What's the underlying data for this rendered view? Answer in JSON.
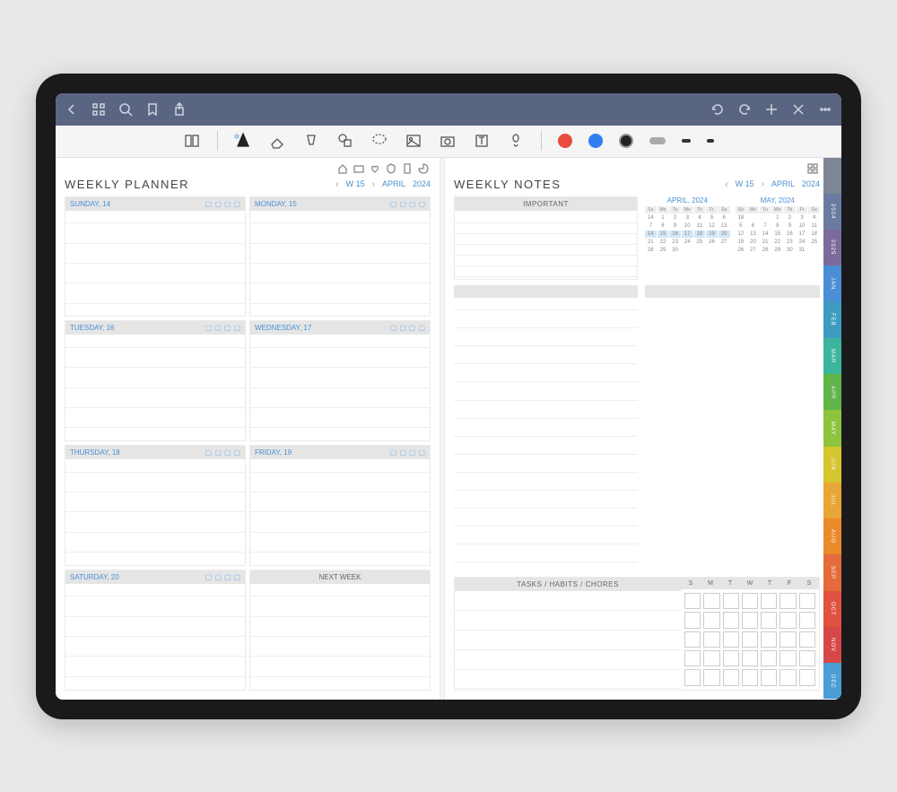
{
  "titlebar_accent": "#5a6582",
  "left_page": {
    "title": "WEEKLY PLANNER",
    "nav": {
      "week": "W 15",
      "month": "APRIL",
      "year": "2024"
    },
    "days": [
      {
        "label": "SUNDAY, 14"
      },
      {
        "label": "MONDAY, 15"
      },
      {
        "label": "TUESDAY, 16"
      },
      {
        "label": "WEDNESDAY, 17"
      },
      {
        "label": "THURSDAY, 18"
      },
      {
        "label": "FRIDAY, 19"
      },
      {
        "label": "SATURDAY, 20"
      },
      {
        "label": "NEXT WEEK"
      }
    ]
  },
  "right_page": {
    "title": "WEEKLY NOTES",
    "nav": {
      "week": "W 15",
      "month": "APRIL",
      "year": "2024"
    },
    "important_label": "IMPORTANT",
    "tasks_label": "TASKS / HABITS / CHORES",
    "week_days": [
      "S",
      "M",
      "T",
      "W",
      "T",
      "F",
      "S"
    ],
    "calendars": [
      {
        "title": "APRIL, 2024",
        "dow": [
          "Su",
          "Mo",
          "Tu",
          "We",
          "Th",
          "Fr",
          "Sa"
        ],
        "rows": [
          [
            "14",
            "1",
            "2",
            "3",
            "4",
            "5",
            "6"
          ],
          [
            "7",
            "8",
            "9",
            "10",
            "11",
            "12",
            "13"
          ],
          [
            "14",
            "15",
            "16",
            "17",
            "18",
            "19",
            "20"
          ],
          [
            "21",
            "22",
            "23",
            "24",
            "25",
            "26",
            "27"
          ],
          [
            "28",
            "29",
            "30",
            "",
            "",
            "",
            ""
          ]
        ],
        "highlight_row": 2
      },
      {
        "title": "MAY, 2024",
        "dow": [
          "Su",
          "Mo",
          "Tu",
          "We",
          "Th",
          "Fr",
          "Sa"
        ],
        "rows": [
          [
            "18",
            "",
            "",
            "1",
            "2",
            "3",
            "4"
          ],
          [
            "5",
            "6",
            "7",
            "8",
            "9",
            "10",
            "11"
          ],
          [
            "12",
            "13",
            "14",
            "15",
            "16",
            "17",
            "18"
          ],
          [
            "19",
            "20",
            "21",
            "22",
            "23",
            "24",
            "25"
          ],
          [
            "26",
            "27",
            "28",
            "29",
            "30",
            "31",
            ""
          ]
        ],
        "highlight_row": -1
      }
    ]
  },
  "side_tabs": [
    {
      "label": "",
      "color": "#7e8796"
    },
    {
      "label": "2024",
      "color": "#6b7aa0"
    },
    {
      "label": "2025",
      "color": "#7d6a9c"
    },
    {
      "label": "JAN",
      "color": "#4a8fd4"
    },
    {
      "label": "FEB",
      "color": "#3e9cc2"
    },
    {
      "label": "MAR",
      "color": "#3db59e"
    },
    {
      "label": "APR",
      "color": "#5fb548"
    },
    {
      "label": "MAY",
      "color": "#8ec43d"
    },
    {
      "label": "JUN",
      "color": "#d4c62e"
    },
    {
      "label": "JUL",
      "color": "#e8a634"
    },
    {
      "label": "AUG",
      "color": "#eb8a2a"
    },
    {
      "label": "SEP",
      "color": "#e56b3a"
    },
    {
      "label": "OCT",
      "color": "#e0523f"
    },
    {
      "label": "NOV",
      "color": "#d64848"
    },
    {
      "label": "DEC",
      "color": "#4a9ed4"
    }
  ]
}
